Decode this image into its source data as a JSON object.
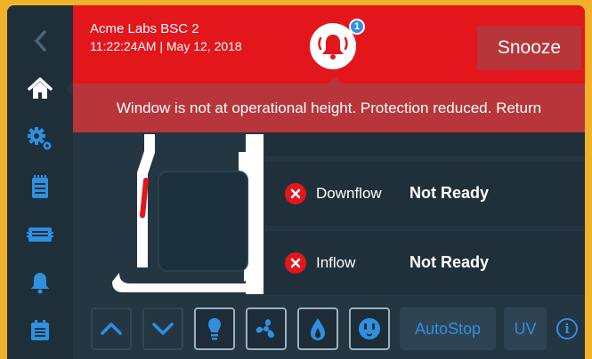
{
  "colors": {
    "accent": "#2f8fe0",
    "alarm_red": "#e3161c",
    "alarm_dark_red": "#b8363a",
    "background": "#243642",
    "frame": "#f1b22a"
  },
  "sidebar": {
    "items": [
      {
        "icon": "chevron-left-icon",
        "active": false
      },
      {
        "icon": "home-icon",
        "active": true
      },
      {
        "icon": "gears-icon",
        "active": false
      },
      {
        "icon": "notepad-icon",
        "active": false
      },
      {
        "icon": "display-icon",
        "active": false
      },
      {
        "icon": "bell-icon",
        "active": false
      },
      {
        "icon": "calendar-list-icon",
        "active": false
      }
    ]
  },
  "alarm": {
    "cabinet_name": "Acme Labs BSC 2",
    "timestamp": "11:22:24AM | May 12, 2018",
    "badge_count": "1",
    "snooze_label": "Snooze",
    "message": "Window is not at operational height. Protection reduced. Return"
  },
  "sash": {
    "height_level": 0.55
  },
  "status_items": [
    {
      "name": "Downflow",
      "status": "Not Ready",
      "state_icon": "error-x-icon"
    },
    {
      "name": "Inflow",
      "status": "Not Ready",
      "state_icon": "error-x-icon"
    }
  ],
  "toolbar": {
    "up_icon": "chevron-up-icon",
    "down_icon": "chevron-down-icon",
    "light_icon": "light-bulb-icon",
    "fan_icon": "fan-icon",
    "gas_icon": "flame-drop-icon",
    "outlet_icon": "power-outlet-icon",
    "autostop_label": "AutoStop",
    "uv_label": "UV",
    "info_glyph": "i"
  }
}
